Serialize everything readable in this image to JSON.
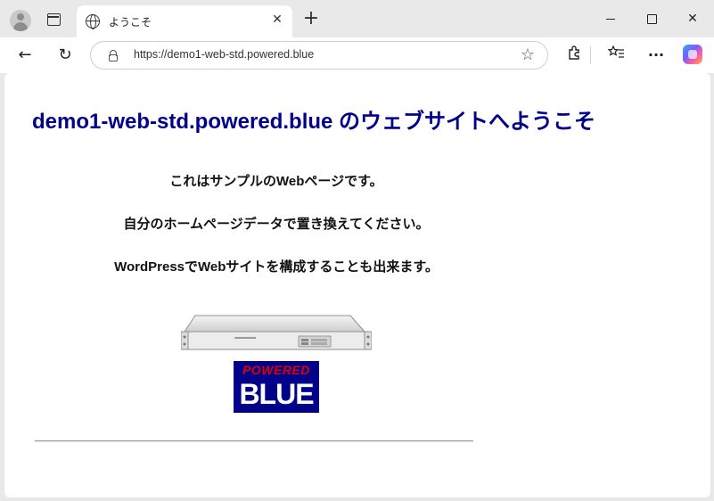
{
  "browser": {
    "tab": {
      "title": "ようこそ",
      "close_label": "✕"
    },
    "new_tab_label": "+",
    "window_controls": {
      "close_label": "✕"
    },
    "toolbar": {
      "back_label": "←",
      "refresh_label": "↻",
      "favorites_label": "☆",
      "more_label": "···"
    },
    "address": {
      "url": "https://demo1-web-std.powered.blue"
    },
    "icons": [
      "avatar",
      "tab-actions-icon",
      "globe-icon",
      "lock-icon",
      "star-icon",
      "extensions-icon",
      "favorites-icon",
      "more-icon",
      "copilot-icon"
    ]
  },
  "page": {
    "heading": "demo1-web-std.powered.blue のウェブサイトへようこそ",
    "paragraphs": [
      "これはサンプルのWebページです。",
      "自分のホームページデータで置き換えてください。",
      "WordPressでWebサイトを構成することも出来ます。"
    ],
    "logo": {
      "top": "POWERED",
      "bottom": "BLUE",
      "colors": {
        "bg": "#00008b",
        "top": "#e00000",
        "bottom": "#ffffff"
      }
    },
    "colors": {
      "heading": "#00008b"
    }
  }
}
